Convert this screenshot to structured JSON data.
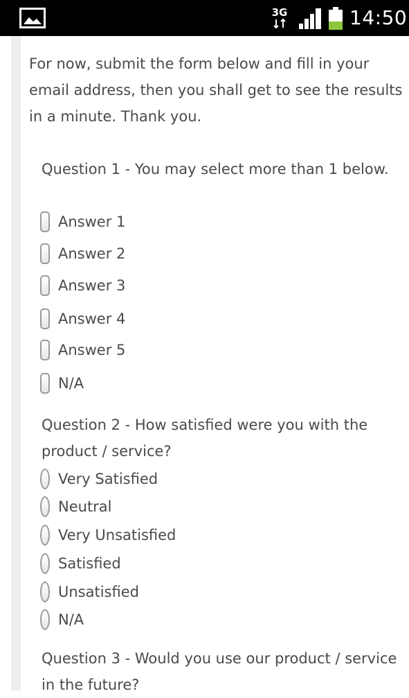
{
  "status_bar": {
    "left_icon": "image-notification-icon",
    "network": "3G",
    "signal_icon": "signal-icon",
    "battery_icon": "battery-icon",
    "time": "14:50"
  },
  "intro_text": "For now, submit the form below and fill in your email address, then you shall get to see the results in a minute. Thank you.",
  "questions": [
    {
      "title": "Question 1 - You may select more than 1 below.",
      "type": "checkbox",
      "options": [
        "Answer 1",
        "Answer 2",
        "Answer 3",
        "Answer 4",
        "Answer 5",
        "N/A"
      ]
    },
    {
      "title": "Question 2 - How satisfied were you with the product / service?",
      "type": "radio",
      "options": [
        "Very Satisfied",
        "Neutral",
        "Very Unsatisfied",
        "Satisfied",
        "Unsatisfied",
        "N/A"
      ]
    },
    {
      "title": "Question 3 - Would you use our product / service in the future?",
      "type": "radio",
      "options": []
    }
  ],
  "colors": {
    "status_bar_bg": "#000000",
    "text": "#4a4a4a",
    "battery_level": "#8cc63e",
    "rail": "#ededed"
  }
}
